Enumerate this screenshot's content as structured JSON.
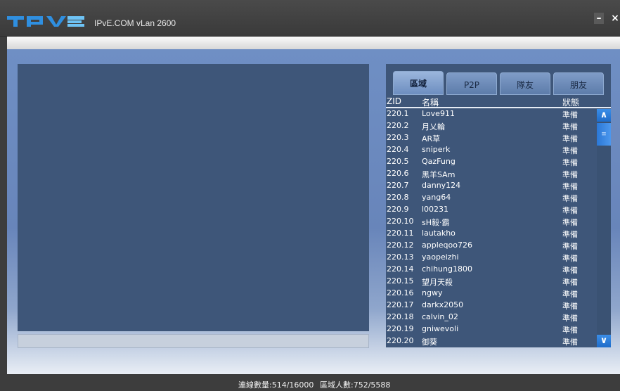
{
  "app": {
    "title": "IPvE.COM vLan 2600",
    "min_label": "–",
    "close_label": "×"
  },
  "tabs": [
    {
      "label": "區域"
    },
    {
      "label": "P2P"
    },
    {
      "label": "隊友"
    },
    {
      "label": "朋友"
    }
  ],
  "list": {
    "headers": {
      "zid": "ZID",
      "name": "名稱",
      "status": "狀態"
    },
    "rows": [
      {
        "zid": "220.1",
        "name": "Love911",
        "status": "準備"
      },
      {
        "zid": "220.2",
        "name": "月乂輪",
        "status": "準備"
      },
      {
        "zid": "220.3",
        "name": "AR草",
        "status": "準備"
      },
      {
        "zid": "220.4",
        "name": "sniperk",
        "status": "準備"
      },
      {
        "zid": "220.5",
        "name": "QazFung",
        "status": "準備"
      },
      {
        "zid": "220.6",
        "name": "黑羊SAm",
        "status": "準備"
      },
      {
        "zid": "220.7",
        "name": "danny124",
        "status": "準備"
      },
      {
        "zid": "220.8",
        "name": "yang64",
        "status": "準備"
      },
      {
        "zid": "220.9",
        "name": "l00231",
        "status": "準備"
      },
      {
        "zid": "220.10",
        "name": "sH毅·霸",
        "status": "準備"
      },
      {
        "zid": "220.11",
        "name": "lautakho",
        "status": "準備"
      },
      {
        "zid": "220.12",
        "name": "appleqoo726",
        "status": "準備"
      },
      {
        "zid": "220.13",
        "name": "yaopeizhi",
        "status": "準備"
      },
      {
        "zid": "220.14",
        "name": "chihung1800",
        "status": "準備"
      },
      {
        "zid": "220.15",
        "name": "望月天殺",
        "status": "準備"
      },
      {
        "zid": "220.16",
        "name": "ngwy",
        "status": "準備"
      },
      {
        "zid": "220.17",
        "name": "darkx2050",
        "status": "準備"
      },
      {
        "zid": "220.18",
        "name": "calvin_02",
        "status": "準備"
      },
      {
        "zid": "220.19",
        "name": "gniwevoli",
        "status": "準備"
      },
      {
        "zid": "220.20",
        "name": "御葵",
        "status": "準備"
      }
    ]
  },
  "scrollbar": {
    "up_label": "∧",
    "down_label": "∨",
    "thumb_label": "≡"
  },
  "status": {
    "connections": "連線數量:514/16000",
    "zone_users": "區域人數:752/5588"
  }
}
